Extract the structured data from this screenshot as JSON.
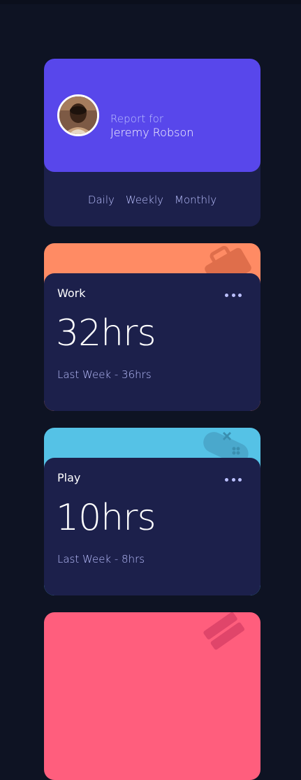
{
  "profile": {
    "report_for": "Report for",
    "name": "Jeremy Robson"
  },
  "tabs": [
    {
      "label": "Daily"
    },
    {
      "label": "Weekly"
    },
    {
      "label": "Monthly"
    }
  ],
  "activities": [
    {
      "title": "Work",
      "hours": "32hrs",
      "previous": "Last Week - 36hrs",
      "color": "#ff8b64",
      "icon": "briefcase-icon"
    },
    {
      "title": "Play",
      "hours": "10hrs",
      "previous": "Last Week - 8hrs",
      "color": "#55c2e6",
      "icon": "gamepad-icon"
    },
    {
      "title": "",
      "hours": "",
      "previous": "",
      "color": "#ff5e7d",
      "icon": "book-icon"
    }
  ],
  "colors": {
    "background": "#0e1323",
    "card": "#1c204b",
    "profile_accent": "#5847eb",
    "muted_text": "#bbc0ff"
  }
}
